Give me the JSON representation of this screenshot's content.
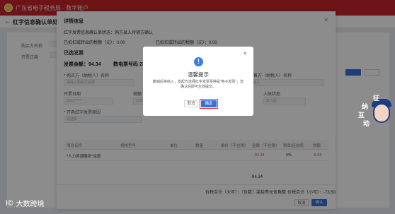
{
  "header": {
    "brand_text": "广东省电子税务局 · 数字账户"
  },
  "subbar": {
    "title": "红字信息确认单处理"
  },
  "background": {
    "row1_label": "购买方名称",
    "row1_value": "*** 有限公司",
    "row2_label": "开票日期",
    "row2_value": "2023-**-**"
  },
  "drawer": {
    "title": "详情信息",
    "subtitle": "红字发票信息确认单状态：购方录入待销方确认",
    "info_line1": "已抵扣或转出的税额（元）：0.00",
    "info_line2": "已抵扣或转出的税额（元）：0.00",
    "section_label": "已选发票",
    "invoice_amount": "发票金额：94.34",
    "invoice_number": "数电票号码 2331200000000",
    "fields": [
      {
        "label": "* 购买方（纳税人）名称",
        "value": "请输入购买方名称"
      },
      {
        "label": "* 销售方（纳税人）名称",
        "value": "请输入"
      },
      {
        "label": "开票日期",
        "value": "2023-**-**"
      },
      {
        "label": "税额",
        "value": "0.00"
      },
      {
        "label": "入账状态",
        "value": "未入账"
      }
    ],
    "reason_label": "* 开具红字发票原因",
    "reason_value": "请选择",
    "table_headers": [
      "项目名称",
      "规格型号",
      "单位",
      "数量",
      "单价（不含税）",
      "金额（不含税）",
      "税率/征收率",
      "税额"
    ],
    "row": {
      "name": "*人力资源服务*派遣",
      "amount": "-94.34",
      "rate": "6%",
      "tax": "-5.66"
    },
    "subtotal": "-94.34",
    "total_label_upper": "价税合计（大写）：（负数）柒拾叁元伍角整",
    "total_label_lower": "价税合计（小写）：-73.50",
    "cancel": "取消",
    "confirm": "确认"
  },
  "dialog": {
    "icon": "info-icon",
    "title": "温馨提示",
    "message": "撤销后将纳入，发起方选择红字发票票种是“电子发票”，您确认后即可生效提交。",
    "cancel": "取消",
    "confirm": "确定"
  },
  "mascot": {
    "chars": [
      "征",
      "纳",
      "互",
      "动"
    ]
  },
  "watermark": {
    "mark": "l©",
    "text": "大数跨境"
  },
  "colors": {
    "header_red": "#c9242a",
    "primary_blue": "#3a6fd8",
    "highlight_red": "#e03030",
    "negative": "#d64545"
  }
}
